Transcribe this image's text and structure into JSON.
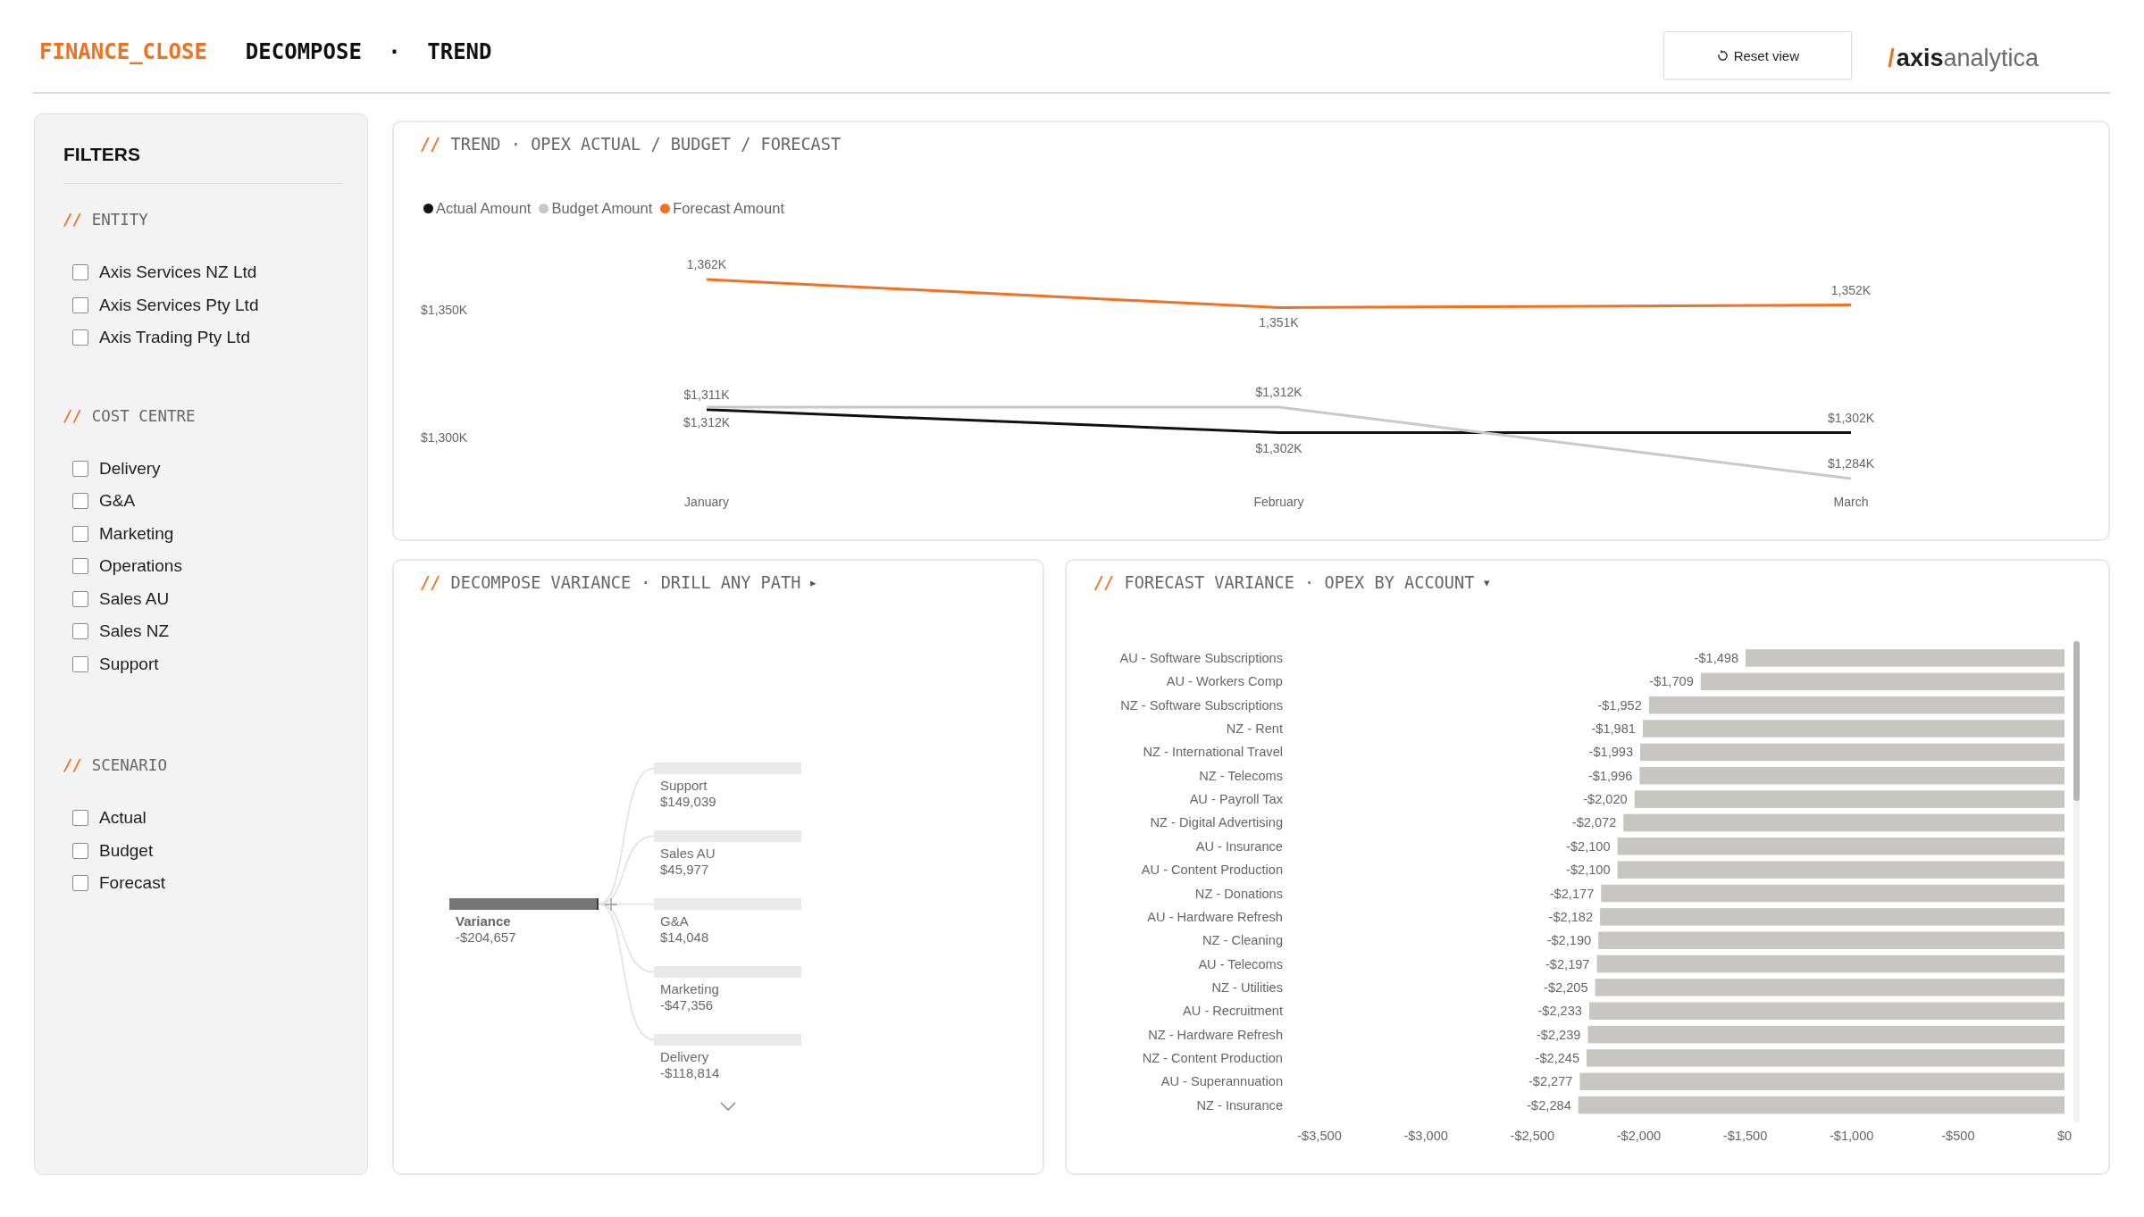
{
  "header": {
    "app_title": "FINANCE_CLOSE",
    "subtitle": "DECOMPOSE · TREND",
    "reset_button": {
      "label": "Reset view"
    },
    "logo": {
      "mark": "/",
      "name": "**axis**analytica"
    }
  },
  "filters": {
    "title": "FILTERS",
    "groups": [
      {
        "marker": "//",
        "title": "ENTITY",
        "options": [
          {
            "label": "Axis Services NZ Ltd",
            "checked": false
          },
          {
            "label": "Axis Services Pty Ltd",
            "checked": false
          },
          {
            "label": "Axis Trading Pty Ltd",
            "checked": false
          }
        ]
      },
      {
        "marker": "//",
        "title": "COST CENTRE",
        "options": [
          {
            "label": "Delivery",
            "checked": false
          },
          {
            "label": "G&A",
            "checked": false
          },
          {
            "label": "Marketing",
            "checked": false
          },
          {
            "label": "Operations",
            "checked": false
          },
          {
            "label": "Sales AU",
            "checked": false
          },
          {
            "label": "Sales NZ",
            "checked": false
          },
          {
            "label": "Support",
            "checked": false
          }
        ]
      },
      {
        "marker": "//",
        "title": "SCENARIO",
        "options": [
          {
            "label": "Actual",
            "checked": false
          },
          {
            "label": "Budget",
            "checked": false
          },
          {
            "label": "Forecast",
            "checked": false
          }
        ]
      }
    ]
  },
  "trend_panel": {
    "marker": "//",
    "title": "TREND · OPEX ACTUAL / BUDGET / FORECAST",
    "chart_data": {
      "type": "line",
      "categories": [
        "January",
        "February",
        "March"
      ],
      "series": [
        {
          "name": "Actual Amount",
          "color": "#111111",
          "values": [
            1311,
            1302,
            1302
          ]
        },
        {
          "name": "Budget Amount",
          "color": "#c8c8c8",
          "values": [
            1312,
            1312,
            1284
          ]
        },
        {
          "name": "Forecast Amount",
          "color": "#f37021",
          "values": [
            1362,
            1351,
            1352
          ]
        }
      ],
      "ylim": [
        1260,
        1425
      ],
      "yticks": [
        {
          "value": 1300,
          "label": "$1,300K"
        },
        {
          "value": 1350,
          "label": "$1,350K"
        }
      ],
      "value_labels": [
        [
          "$1,311K",
          "$1,302K",
          "$1,302K"
        ],
        [
          "$1,312K",
          "$1,312K",
          "$1,284K"
        ],
        [
          "1,362K",
          "1,351K",
          "1,352K"
        ]
      ]
    }
  },
  "decompose_panel": {
    "marker": "//",
    "title": "DECOMPOSE VARIANCE · DRILL ANY PATH",
    "caret": "▸",
    "tree": {
      "label": "Variance",
      "value": "-$204,657",
      "children": [
        {
          "label": "Support",
          "value": "$149,039"
        },
        {
          "label": "Sales AU",
          "value": "$45,977"
        },
        {
          "label": "G&A",
          "value": "$14,048"
        },
        {
          "label": "Marketing",
          "value": "-$47,356"
        },
        {
          "label": "Delivery",
          "value": "-$118,814"
        }
      ]
    }
  },
  "forecast_panel": {
    "marker": "//",
    "title": "FORECAST VARIANCE · OPEX BY ACCOUNT",
    "caret": "▾",
    "chart_data": {
      "type": "bar",
      "orientation": "horizontal",
      "categories": [
        "AU - Software Subscriptions",
        "AU - Workers Comp",
        "NZ - Software Subscriptions",
        "NZ - Rent",
        "NZ - International Travel",
        "NZ - Telecoms",
        "AU - Payroll Tax",
        "NZ - Digital Advertising",
        "AU - Insurance",
        "AU - Content Production",
        "NZ - Donations",
        "AU - Hardware Refresh",
        "NZ - Cleaning",
        "AU - Telecoms",
        "NZ - Utilities",
        "AU - Recruitment",
        "NZ - Hardware Refresh",
        "NZ - Content Production",
        "AU - Superannuation",
        "NZ - Insurance"
      ],
      "values": [
        -1498,
        -1709,
        -1952,
        -1981,
        -1993,
        -1996,
        -2020,
        -2072,
        -2100,
        -2100,
        -2177,
        -2182,
        -2190,
        -2197,
        -2205,
        -2233,
        -2239,
        -2245,
        -2277,
        -2284
      ],
      "value_labels": [
        "-$1,498",
        "-$1,709",
        "-$1,952",
        "-$1,981",
        "-$1,993",
        "-$1,996",
        "-$2,020",
        "-$2,072",
        "-$2,100",
        "-$2,100",
        "-$2,177",
        "-$2,182",
        "-$2,190",
        "-$2,197",
        "-$2,205",
        "-$2,233",
        "-$2,239",
        "-$2,245",
        "-$2,277",
        "-$2,284"
      ],
      "xlim": [
        -3500,
        0
      ],
      "xticks": [
        {
          "value": -3500,
          "label": "-$3,500"
        },
        {
          "value": -3000,
          "label": "-$3,000"
        },
        {
          "value": -2500,
          "label": "-$2,500"
        },
        {
          "value": -2000,
          "label": "-$2,000"
        },
        {
          "value": -1500,
          "label": "-$1,500"
        },
        {
          "value": -1000,
          "label": "-$1,000"
        },
        {
          "value": -500,
          "label": "-$500"
        },
        {
          "value": 0,
          "label": "$0"
        }
      ]
    }
  }
}
